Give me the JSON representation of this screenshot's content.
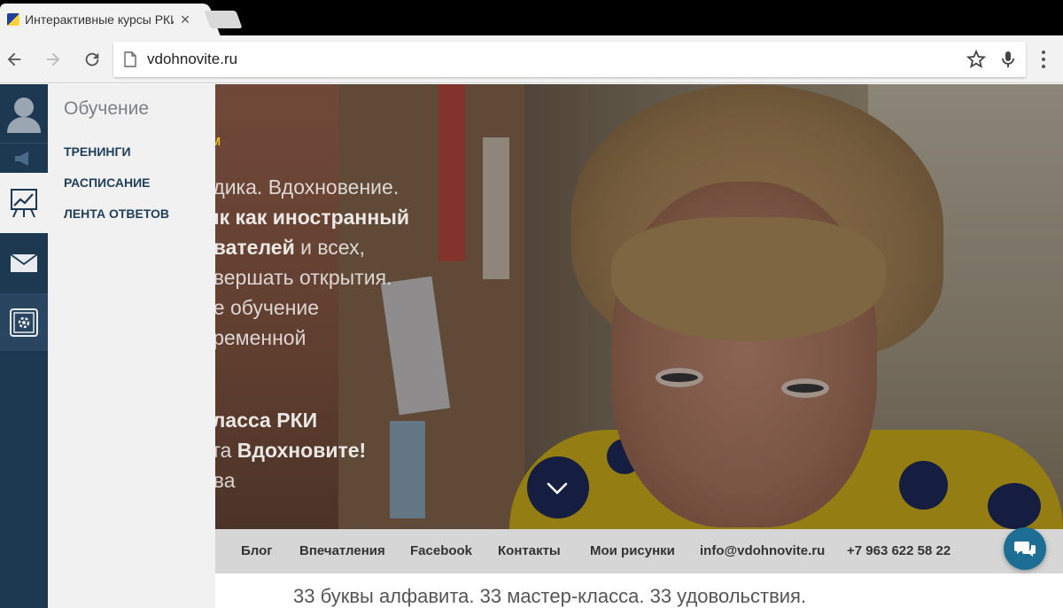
{
  "browser": {
    "tab_title": "Интерактивные курсы РКИ",
    "url": "vdohnovite.ru"
  },
  "sidebar": {
    "panel_title": "Обучение",
    "links": [
      {
        "label": "ТРЕНИНГИ"
      },
      {
        "label": "РАСПИСАНИЕ"
      },
      {
        "label": "ЛЕНТА ОТВЕТОВ"
      }
    ],
    "rail_icons": [
      "user-icon",
      "megaphone-icon",
      "chart-icon",
      "mail-icon",
      "settings-icon"
    ]
  },
  "hero": {
    "lines": {
      "l0": "ОМ",
      "l1": "одика. Вдохновение.",
      "l2": "ык как иностранный",
      "l3a": "авателей",
      "l3b": " и всех,",
      "l4": "овершать открытия.",
      "l5": "ое обучение",
      "l6": "временной",
      "l7": "класса РКИ",
      "l8a": "кта ",
      "l8b": "Вдохновите!",
      "l9": "ева"
    }
  },
  "bottom_nav": {
    "items": [
      "Блог",
      "Впечатления",
      "Facebook",
      "Контакты",
      "Мои рисунки",
      "info@vdohnovite.ru",
      "+7 963 622 58 22"
    ]
  },
  "tagline": "33 буквы алфавита. 33 мастер-класса. 33 удовольствия.",
  "colors": {
    "rail": "#1d3851",
    "panel": "#f1f1f1",
    "link": "#1f3e5b",
    "accent_yellow": "#e6c21e",
    "chat_button": "#1c6e95"
  }
}
